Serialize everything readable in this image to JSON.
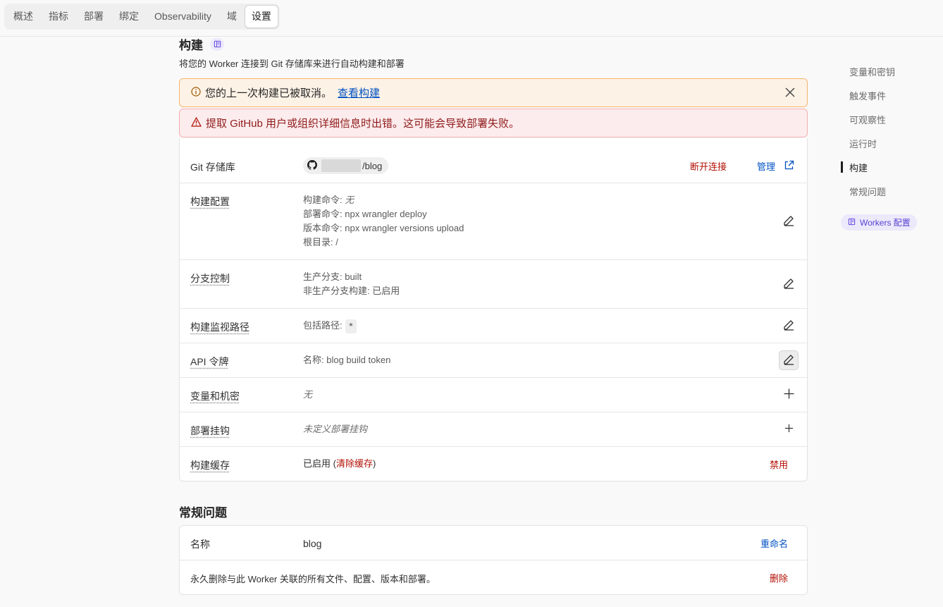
{
  "tabs": [
    {
      "label": "概述"
    },
    {
      "label": "指标"
    },
    {
      "label": "部署"
    },
    {
      "label": "绑定"
    },
    {
      "label": "Observability"
    },
    {
      "label": "域"
    },
    {
      "label": "设置"
    }
  ],
  "build": {
    "title": "构建",
    "description": "将您的 Worker 连接到 Git 存储库来进行自动构建和部署",
    "warning": {
      "text": "您的上一次构建已被取消。",
      "link": "查看构建"
    },
    "error": {
      "text": "提取 GitHub 用户或组织详细信息时出错。这可能会导致部署失败。"
    },
    "rows": {
      "repo": {
        "label": "Git 存储库",
        "repo_suffix": "/blog",
        "disconnect": "断开连接",
        "manage": "管理"
      },
      "config": {
        "label": "构建配置",
        "lines": [
          {
            "k": "构建命令: ",
            "v": "无"
          },
          {
            "k": "部署命令: ",
            "v": "npx wrangler deploy"
          },
          {
            "k": "版本命令: ",
            "v": "npx wrangler versions upload"
          },
          {
            "k": "根目录: ",
            "v": "/"
          }
        ]
      },
      "branch": {
        "label": "分支控制",
        "line1": "生产分支: built",
        "line2": "非生产分支构建: 已启用"
      },
      "watch": {
        "label": "构建监视路径",
        "prefix": "包括路径:",
        "path": "*"
      },
      "token": {
        "label": "API 令牌",
        "value": "名称: blog build token"
      },
      "vars": {
        "label": "变量和机密",
        "value": "无"
      },
      "hooks": {
        "label": "部署挂钩",
        "value": "未定义部署挂钩"
      },
      "cache": {
        "label": "构建缓存",
        "prefix": "已启用 (",
        "clear": "清除缓存",
        "suffix": ")",
        "disable": "禁用"
      }
    }
  },
  "general": {
    "title": "常规问题",
    "name_label": "名称",
    "name_value": "blog",
    "rename": "重命名",
    "delete_text": "永久删除与此 Worker 关联的所有文件、配置、版本和部署。",
    "delete": "删除"
  },
  "rightnav": {
    "items": [
      {
        "label": "变量和密钥"
      },
      {
        "label": "触发事件"
      },
      {
        "label": "可观察性"
      },
      {
        "label": "运行时"
      },
      {
        "label": "构建"
      },
      {
        "label": "常规问题"
      }
    ],
    "workers_chip": "Workers 配置"
  },
  "colors": {
    "accent_purple": "#5a3fcf",
    "link_blue": "#0051c3",
    "danger_red": "#b20f03"
  }
}
